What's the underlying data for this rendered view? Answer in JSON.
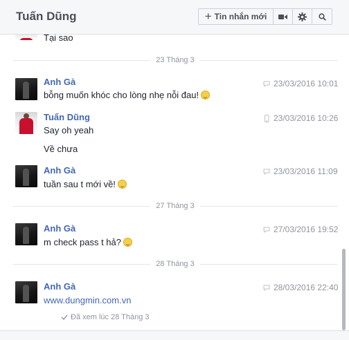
{
  "header": {
    "title": "Tuấn Dũng",
    "new_message_label": "Tin nhắn mới",
    "icons": [
      "plus-icon",
      "video-camera-icon",
      "gear-icon",
      "search-icon"
    ]
  },
  "partial_message": "Tại sao",
  "separators": [
    "23 Tháng 3",
    "27 Tháng 3",
    "28 Tháng 3"
  ],
  "messages": [
    {
      "sender": "Anh Gà",
      "text": "bỗng muốn khóc cho lòng nhẹ nỗi đau!",
      "timestamp": "23/03/2016 10:01",
      "source_icon": "chat-bubble-icon"
    },
    {
      "sender": "Tuấn Dũng",
      "text": "Say oh yeah",
      "text2": "Về chưa",
      "timestamp": "23/03/2016 10:26",
      "source_icon": "mobile-icon"
    },
    {
      "sender": "Anh Gà",
      "text": "tuần sau t mới về!",
      "timestamp": "23/03/2016 11:09",
      "source_icon": "chat-bubble-icon"
    },
    {
      "sender": "Anh Gà",
      "text": "m check pass t hả?",
      "timestamp": "27/03/2016 19:52",
      "source_icon": "chat-bubble-icon"
    },
    {
      "sender": "Anh Gà",
      "text": "www.dungmin.com.vn",
      "timestamp": "28/03/2016 22:40",
      "source_icon": "chat-bubble-icon"
    }
  ],
  "seen_status": "Đã xem lúc 28 Tháng 3"
}
